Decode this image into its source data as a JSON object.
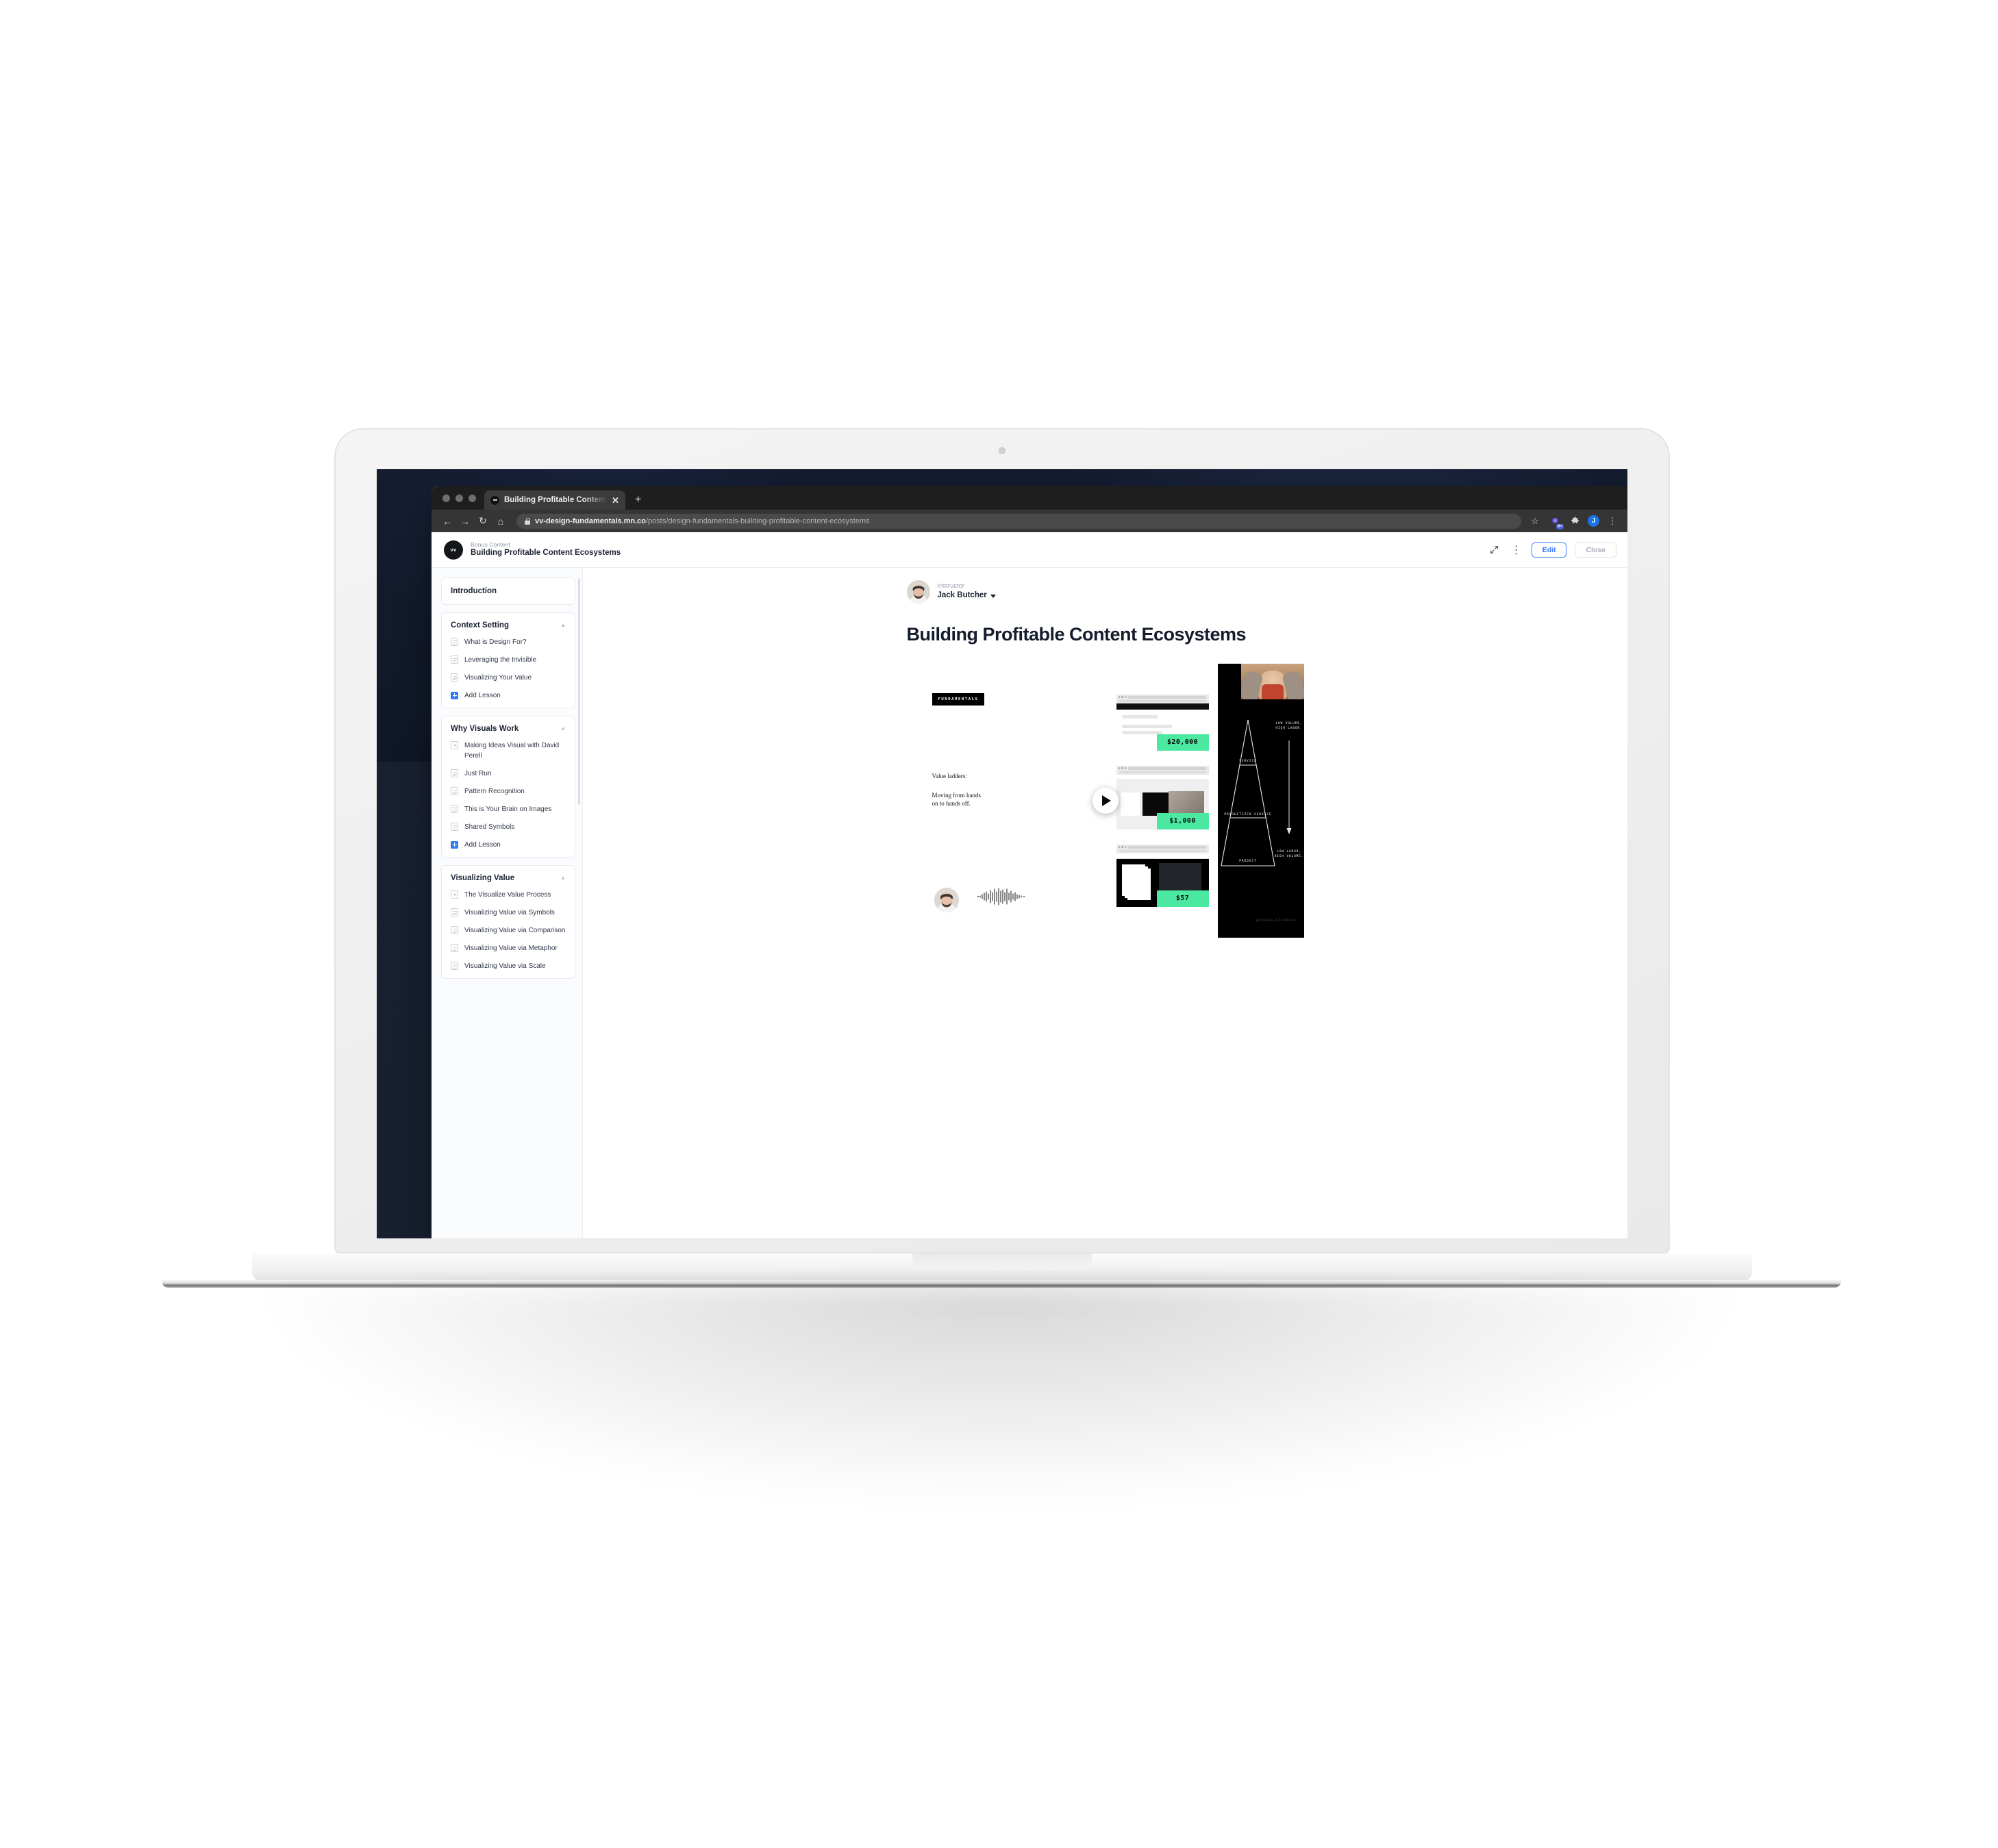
{
  "browser": {
    "tab": {
      "title": "Building Profitable Content Eco",
      "close_label": "✕",
      "newtab_label": "+"
    },
    "nav": {
      "back": "←",
      "forward": "→",
      "reload": "↻",
      "home": "⌂"
    },
    "url": {
      "domain": "vv-design-fundamentals.mn.co",
      "path": "/posts/design-fundamentals-building-profitable-content-ecosystems"
    },
    "toolbar_icons": {
      "bookmark": "☆",
      "extension_badge": "9+",
      "puzzle": "❖",
      "profile_initial": "J",
      "menu": "⋮"
    }
  },
  "app_header": {
    "logo_text": "vv",
    "eyebrow": "Bonus Content",
    "title": "Building Profitable Content Ecosystems",
    "collapse_icon": "⤡",
    "more_icon": "⋮",
    "edit_label": "Edit",
    "close_label": "Close"
  },
  "sidebar": {
    "sections": [
      {
        "title": "Introduction",
        "collapsible": false,
        "items": []
      },
      {
        "title": "Context Setting",
        "caret": "▲",
        "items": [
          {
            "icon": "document-icon",
            "label": "What is Design For?"
          },
          {
            "icon": "document-icon",
            "label": "Leveraging the Invisible"
          },
          {
            "icon": "document-icon",
            "label": "Visualizing Your Value"
          },
          {
            "icon": "plus-icon",
            "label": "Add Lesson"
          }
        ]
      },
      {
        "title": "Why Visuals Work",
        "caret": "▲",
        "items": [
          {
            "icon": "play-icon",
            "label": "Making Ideas Visual with David Perell"
          },
          {
            "icon": "document-icon",
            "label": "Just Run"
          },
          {
            "icon": "document-icon",
            "label": "Pattern Recognition"
          },
          {
            "icon": "document-icon",
            "label": "This is Your Brain on Images"
          },
          {
            "icon": "document-icon",
            "label": "Shared Symbols"
          },
          {
            "icon": "plus-icon",
            "label": "Add Lesson"
          }
        ]
      },
      {
        "title": "Visualizing Value",
        "caret": "▲",
        "items": [
          {
            "icon": "play-icon",
            "label": "The Visualize Value Process"
          },
          {
            "icon": "document-icon",
            "label": "Visualizing Value via Symbols"
          },
          {
            "icon": "document-icon",
            "label": "Visualizing Value via Comparison"
          },
          {
            "icon": "document-icon",
            "label": "Visualizing Value via Metaphor"
          },
          {
            "icon": "document-icon",
            "label": "Visualizing Value via Scale"
          }
        ]
      }
    ]
  },
  "main": {
    "instructor_label": "Instructor",
    "instructor_name": "Jack Butcher",
    "post_title": "Building Profitable Content Ecosystems",
    "video": {
      "tag": "FUNDAMENTALS",
      "headline": "Value ladders:",
      "subline": "Moving from hands\non to hands off.",
      "play_label": "play-button",
      "watermark": "@VISUALIZEVALUE",
      "cards": [
        {
          "price": "$20,000"
        },
        {
          "price": "$1,000"
        },
        {
          "price": "$57"
        }
      ],
      "pyramid": {
        "tiers": [
          "SERVICE",
          "PRODUCTIZED SERVICE",
          "PRODUCT"
        ],
        "top_label": "LOW VOLUME,\nHIGH LABOR.",
        "bottom_label": "LOW LABOR,\nHIGH VOLUME."
      }
    }
  },
  "colors": {
    "accent_blue": "#3a7afe",
    "accent_green": "#4ae8a0",
    "text_dark": "#151c2c",
    "muted": "#9aa0ae"
  }
}
